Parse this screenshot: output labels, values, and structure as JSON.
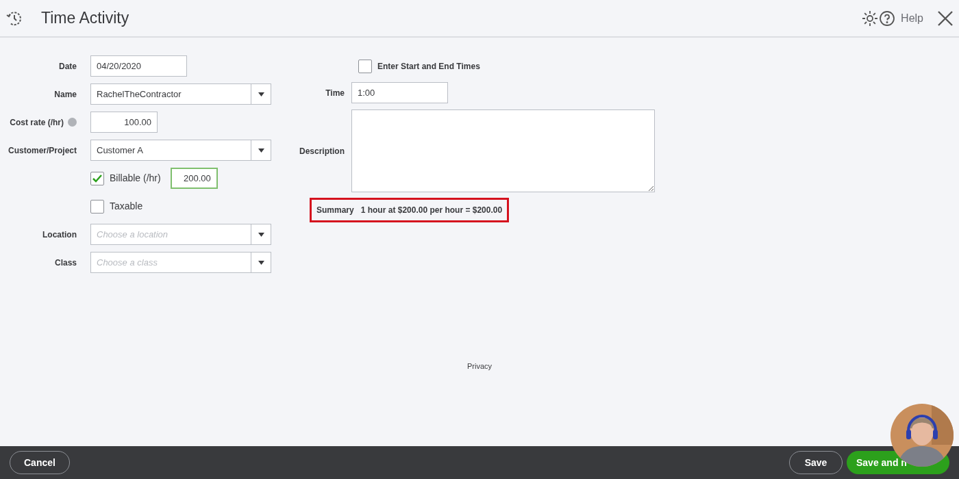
{
  "header": {
    "title": "Time Activity",
    "help": "Help"
  },
  "left_fields": [
    {
      "kind": "text",
      "label": "Date",
      "value": "04/20/2020"
    },
    {
      "kind": "select",
      "label": "Name",
      "value": "RachelTheContractor"
    },
    {
      "kind": "rate",
      "label": "Cost rate (/hr)",
      "value": "100.00",
      "info": true
    },
    {
      "kind": "select",
      "label": "Customer/Project",
      "value": "Customer A"
    },
    {
      "kind": "check",
      "label": "Billable (/hr)",
      "checked": true,
      "rate": "200.00"
    },
    {
      "kind": "check",
      "label": "Taxable",
      "checked": false
    },
    {
      "kind": "select",
      "label": "Location",
      "placeholder": "Choose a location"
    },
    {
      "kind": "select",
      "label": "Class",
      "placeholder": "Choose a class"
    }
  ],
  "start_end": {
    "label": "Enter Start and End Times",
    "checked": false
  },
  "time": {
    "label": "Time",
    "value": "1:00"
  },
  "description": {
    "label": "Description"
  },
  "summary": {
    "label": "Summary",
    "text": "1 hour at $200.00 per hour = $200.00",
    "highlighted": true
  },
  "privacy": "Privacy",
  "footer": {
    "cancel": "Cancel",
    "save": "Save",
    "save_and_new": "Save and n"
  }
}
